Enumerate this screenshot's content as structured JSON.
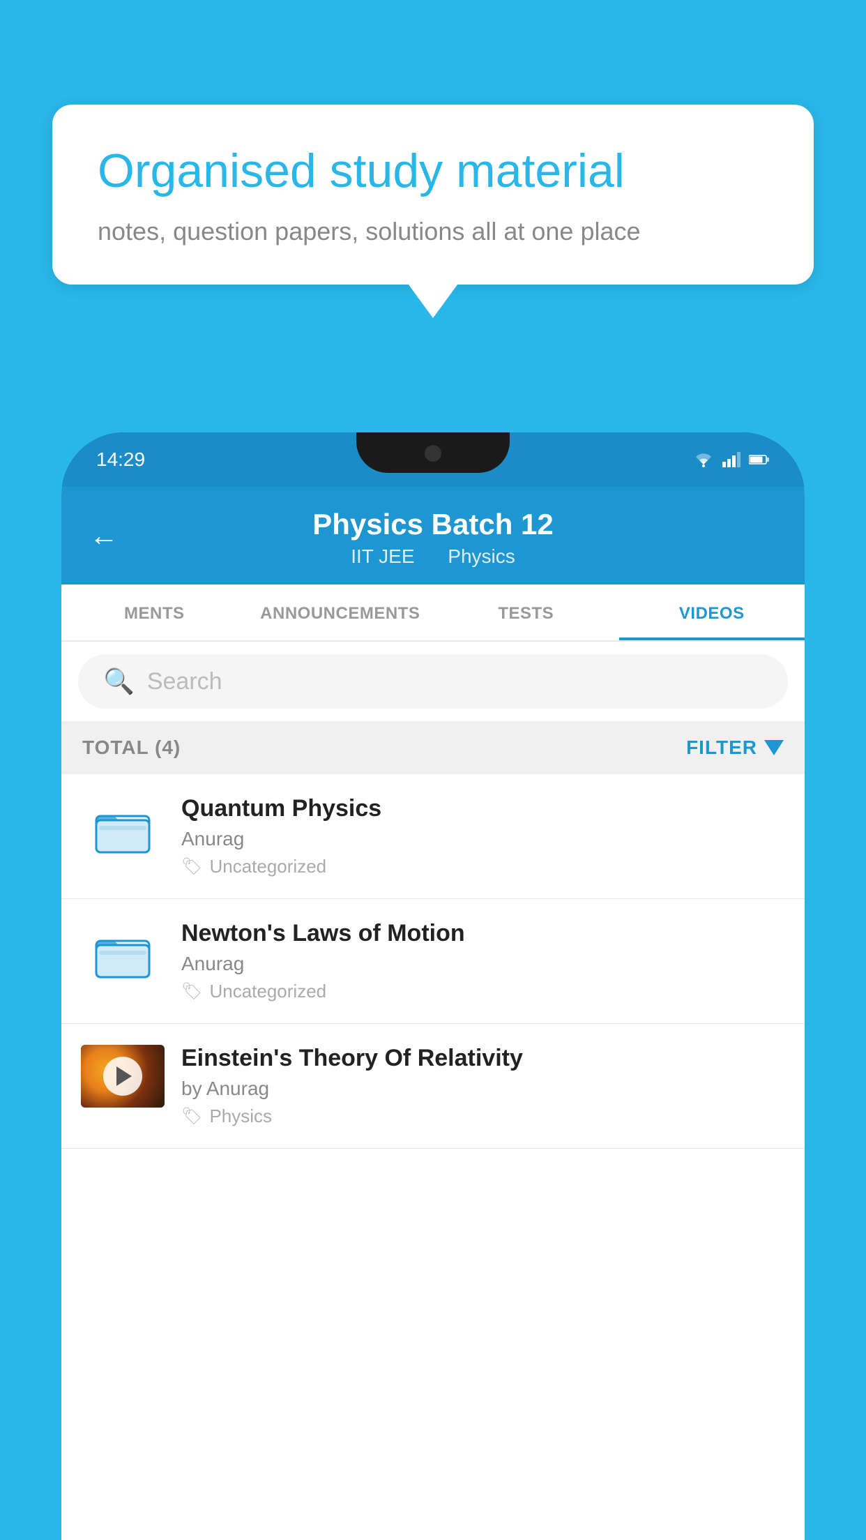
{
  "background_color": "#29b6e8",
  "bubble": {
    "title": "Organised study material",
    "subtitle": "notes, question papers, solutions all at one place"
  },
  "phone": {
    "status_bar": {
      "time": "14:29",
      "icons": [
        "wifi",
        "signal",
        "battery"
      ]
    },
    "header": {
      "back_label": "←",
      "title": "Physics Batch 12",
      "subtitle_part1": "IIT JEE",
      "subtitle_part2": "Physics"
    },
    "tabs": [
      {
        "label": "MENTS",
        "active": false
      },
      {
        "label": "ANNOUNCEMENTS",
        "active": false
      },
      {
        "label": "TESTS",
        "active": false
      },
      {
        "label": "VIDEOS",
        "active": true
      }
    ],
    "search": {
      "placeholder": "Search"
    },
    "filter_bar": {
      "total_label": "TOTAL (4)",
      "filter_label": "FILTER"
    },
    "videos": [
      {
        "id": 1,
        "title": "Quantum Physics",
        "author": "Anurag",
        "tag": "Uncategorized",
        "type": "folder",
        "has_thumbnail": false
      },
      {
        "id": 2,
        "title": "Newton's Laws of Motion",
        "author": "Anurag",
        "tag": "Uncategorized",
        "type": "folder",
        "has_thumbnail": false
      },
      {
        "id": 3,
        "title": "Einstein's Theory Of Relativity",
        "author": "by Anurag",
        "tag": "Physics",
        "type": "video",
        "has_thumbnail": true
      }
    ]
  }
}
